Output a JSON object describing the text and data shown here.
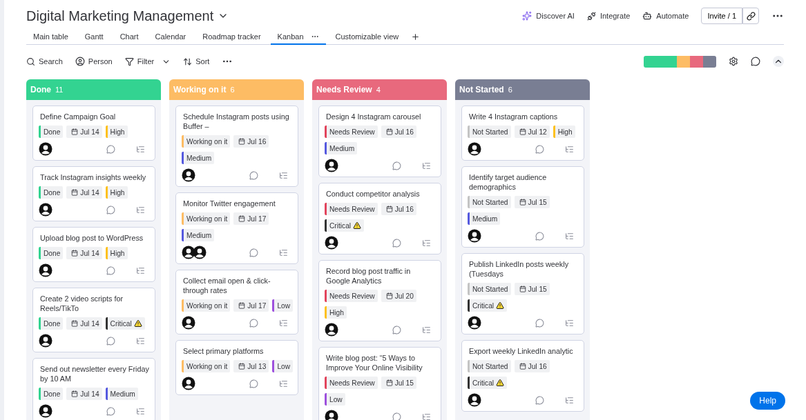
{
  "board": {
    "title": "Digital Marketing Management"
  },
  "header_actions": [
    {
      "label": "Discover AI",
      "kind": "ai"
    },
    {
      "label": "Integrate",
      "kind": "integrate"
    },
    {
      "label": "Automate",
      "kind": "automate"
    }
  ],
  "invite": "Invite / 1",
  "views": [
    {
      "label": "Main table",
      "selected": false
    },
    {
      "label": "Gantt",
      "selected": false
    },
    {
      "label": "Chart",
      "selected": false
    },
    {
      "label": "Calendar",
      "selected": false
    },
    {
      "label": "Roadmap tracker",
      "selected": false
    },
    {
      "label": "Kanban",
      "selected": true
    },
    {
      "label": "Customizable view",
      "selected": false
    }
  ],
  "toolbar": [
    {
      "label": "Search",
      "kind": "search"
    },
    {
      "label": "Person",
      "kind": "person"
    },
    {
      "label": "Filter",
      "kind": "filter"
    },
    {
      "label": "Sort",
      "kind": "sort"
    }
  ],
  "columns": [
    {
      "title": "Done",
      "count": "11",
      "color": "#33d391",
      "cards": [
        {
          "title": "Define Campaign Goal",
          "status": {
            "label": "Done",
            "color": "#33d391"
          },
          "date": "Jul 14",
          "priority": {
            "label": "High",
            "color": "#fdc11f",
            "warning": false
          },
          "multiple_assignees": false
        },
        {
          "title": "Track Instagram insights weekly",
          "status": {
            "label": "Done",
            "color": "#33d391"
          },
          "date": "Jul 14",
          "priority": {
            "label": "High",
            "color": "#fdc11f",
            "warning": false
          },
          "multiple_assignees": false
        },
        {
          "title": "Upload blog post to WordPress",
          "status": {
            "label": "Done",
            "color": "#33d391"
          },
          "date": "Jul 14",
          "priority": {
            "label": "High",
            "color": "#fdc11f",
            "warning": false
          },
          "multiple_assignees": false
        },
        {
          "title": "Create 2 video scripts for Reels/TikTo",
          "status": {
            "label": "Done",
            "color": "#33d391"
          },
          "date": "Jul 14",
          "priority": {
            "label": "Critical",
            "color": "#333333",
            "warning": true
          },
          "multiple_assignees": false
        },
        {
          "title": "Send out newsletter every Friday by 10 AM",
          "status": {
            "label": "Done",
            "color": "#33d391"
          },
          "date": "Jul 14",
          "priority": {
            "label": "Medium",
            "color": "#5559df",
            "warning": false
          },
          "multiple_assignees": false
        }
      ]
    },
    {
      "title": "Working on it",
      "count": "6",
      "color": "#fdbc64",
      "cards": [
        {
          "title": "Schedule Instagram posts using Buffer –",
          "status": {
            "label": "Working on it",
            "color": "#fdbc64"
          },
          "date": "Jul 16",
          "priority": {
            "label": "Medium",
            "color": "#5559df",
            "warning": false
          },
          "multiple_assignees": false
        },
        {
          "title": "Monitor Twitter engagement",
          "status": {
            "label": "Working on it",
            "color": "#fdbc64"
          },
          "date": "Jul 17",
          "priority": {
            "label": "Medium",
            "color": "#5559df",
            "warning": false
          },
          "multiple_assignees": true
        },
        {
          "title": "Collect email open & click-through rates",
          "status": {
            "label": "Working on it",
            "color": "#fdbc64"
          },
          "date": "Jul 17",
          "priority": {
            "label": "Low",
            "color": "#9d50dd",
            "warning": false
          },
          "multiple_assignees": false
        },
        {
          "title": "Select primary platforms",
          "status": {
            "label": "Working on it",
            "color": "#fdbc64"
          },
          "date": "Jul 13",
          "priority": {
            "label": "Low",
            "color": "#9d50dd",
            "warning": false
          },
          "multiple_assignees": false
        }
      ]
    },
    {
      "title": "Needs Review",
      "count": "4",
      "color": "#e8697d",
      "cards": [
        {
          "title": "Design 4 Instagram carousel",
          "status": {
            "label": "Needs Review",
            "color": "#e2445c"
          },
          "date": "Jul 16",
          "priority": {
            "label": "Medium",
            "color": "#5559df",
            "warning": false
          },
          "multiple_assignees": false
        },
        {
          "title": "Conduct competitor analysis",
          "status": {
            "label": "Needs Review",
            "color": "#e2445c"
          },
          "date": "Jul 16",
          "priority": {
            "label": "Critical",
            "color": "#333333",
            "warning": true
          },
          "multiple_assignees": false
        },
        {
          "title": "Record blog post traffic in Google Analytics",
          "status": {
            "label": "Needs Review",
            "color": "#e2445c"
          },
          "date": "Jul 20",
          "priority": {
            "label": "High",
            "color": "#fdc11f",
            "warning": false
          },
          "multiple_assignees": false
        },
        {
          "title": "Write blog post: “5 Ways to Improve Your Online Visibility",
          "status": {
            "label": "Needs Review",
            "color": "#e2445c"
          },
          "date": "Jul 15",
          "priority": {
            "label": "Low",
            "color": "#9d50dd",
            "warning": false
          },
          "multiple_assignees": false
        }
      ]
    },
    {
      "title": "Not Started",
      "count": "6",
      "color": "#797e93",
      "cards": [
        {
          "title": "Write 4 Instagram captions",
          "status": {
            "label": "Not Started",
            "color": "#c4c4c4"
          },
          "date": "Jul 12",
          "priority": {
            "label": "High",
            "color": "#fdc11f",
            "warning": false
          },
          "multiple_assignees": false
        },
        {
          "title": "Identify target audience demographics",
          "status": {
            "label": "Not Started",
            "color": "#c4c4c4"
          },
          "date": "Jul 15",
          "priority": {
            "label": "Medium",
            "color": "#5559df",
            "warning": false
          },
          "multiple_assignees": false
        },
        {
          "title": "Publish LinkedIn posts weekly (Tuesdays",
          "status": {
            "label": "Not Started",
            "color": "#c4c4c4"
          },
          "date": "Jul 15",
          "priority": {
            "label": "Critical",
            "color": "#333333",
            "warning": true
          },
          "multiple_assignees": false
        },
        {
          "title": "Export weekly LinkedIn analytic",
          "status": {
            "label": "Not Started",
            "color": "#c4c4c4"
          },
          "date": "Jul 16",
          "priority": {
            "label": "Critical",
            "color": "#333333",
            "warning": true
          },
          "multiple_assignees": false
        }
      ]
    }
  ],
  "help": "Help"
}
